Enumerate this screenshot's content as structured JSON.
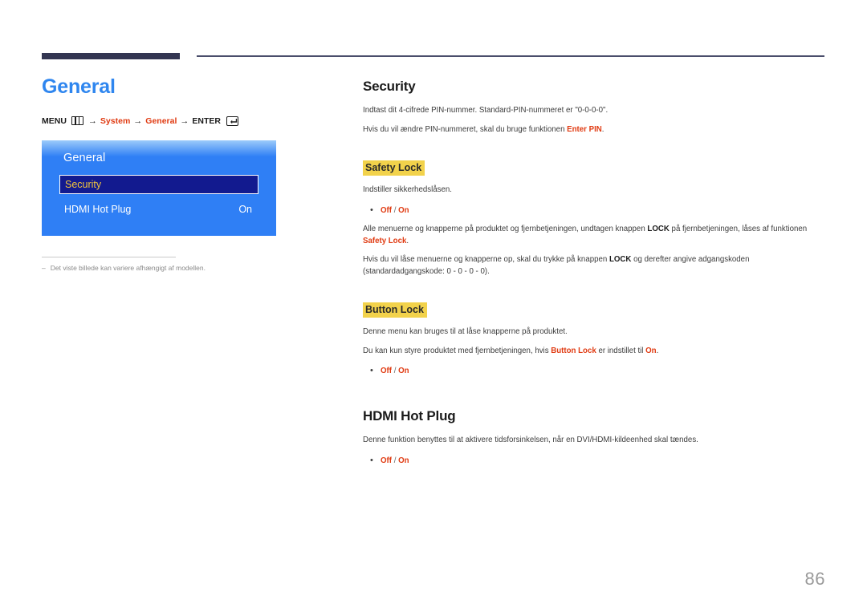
{
  "header": {
    "rule_color_thick": "#333652",
    "rule_color_thin": "#4a4d6b"
  },
  "left": {
    "chapter_title": "General",
    "breadcrumb": {
      "menu_label": "MENU",
      "menu_icon": "menu-grid-icon",
      "arrow": "→",
      "step1": "System",
      "step2": "General",
      "enter_label": "ENTER",
      "enter_icon": "enter-return-icon"
    },
    "osd": {
      "title": "General",
      "rows": [
        {
          "label": "Security",
          "value": "",
          "selected": true
        },
        {
          "label": "HDMI Hot Plug",
          "value": "On",
          "selected": false
        }
      ]
    },
    "note": {
      "dash": "–",
      "text": "Det viste billede kan variere afhængigt af modellen."
    }
  },
  "right": {
    "security": {
      "title": "Security",
      "p1_a": "Indtast dit 4-cifrede PIN-nummer. Standard-PIN-nummeret er \"0-0-0-0\".",
      "p2_a": "Hvis du vil ændre PIN-nummeret, skal du bruge funktionen ",
      "p2_b": "Enter PIN",
      "p2_c": "."
    },
    "safety_lock": {
      "title": "Safety Lock",
      "p1": "Indstiller sikkerhedslåsen.",
      "options": "Off / On",
      "opt_off": "Off",
      "opt_slash": " / ",
      "opt_on": "On",
      "p2_a": "Alle menuerne og knapperne på produktet og fjernbetjeningen, undtagen knappen ",
      "p2_b": "LOCK",
      "p2_c": " på fjernbetjeningen, låses af funktionen ",
      "p2_d": "Safety Lock",
      "p2_e": ".",
      "p3_a": "Hvis du vil låse menuerne og knapperne op, skal du trykke på knappen ",
      "p3_b": "LOCK",
      "p3_c": " og derefter angive adgangskoden (standardadgangskode: 0 - 0 - 0 - 0)."
    },
    "button_lock": {
      "title": "Button Lock",
      "p1": "Denne menu kan bruges til at låse knapperne på produktet.",
      "p2_a": "Du kan kun styre produktet med fjernbetjeningen, hvis ",
      "p2_b": "Button Lock",
      "p2_c": " er indstillet til ",
      "p2_d": "On",
      "p2_e": ".",
      "opt_off": "Off",
      "opt_slash": " / ",
      "opt_on": "On"
    },
    "hdmi_hot_plug": {
      "title": "HDMI Hot Plug",
      "p1": "Denne funktion benyttes til at aktivere tidsforsinkelsen, når en DVI/HDMI-kildeenhed skal tændes.",
      "opt_off": "Off",
      "opt_slash": " / ",
      "opt_on": "On"
    }
  },
  "footer": {
    "page_number": "86"
  },
  "colors": {
    "accent_blue": "#2f86ef",
    "highlight_yellow": "#f2d24b",
    "accent_red": "#e03a11",
    "osd_blue": "#2f7ff5",
    "osd_selected": "#121a8f",
    "osd_selected_text": "#f2c53d"
  }
}
